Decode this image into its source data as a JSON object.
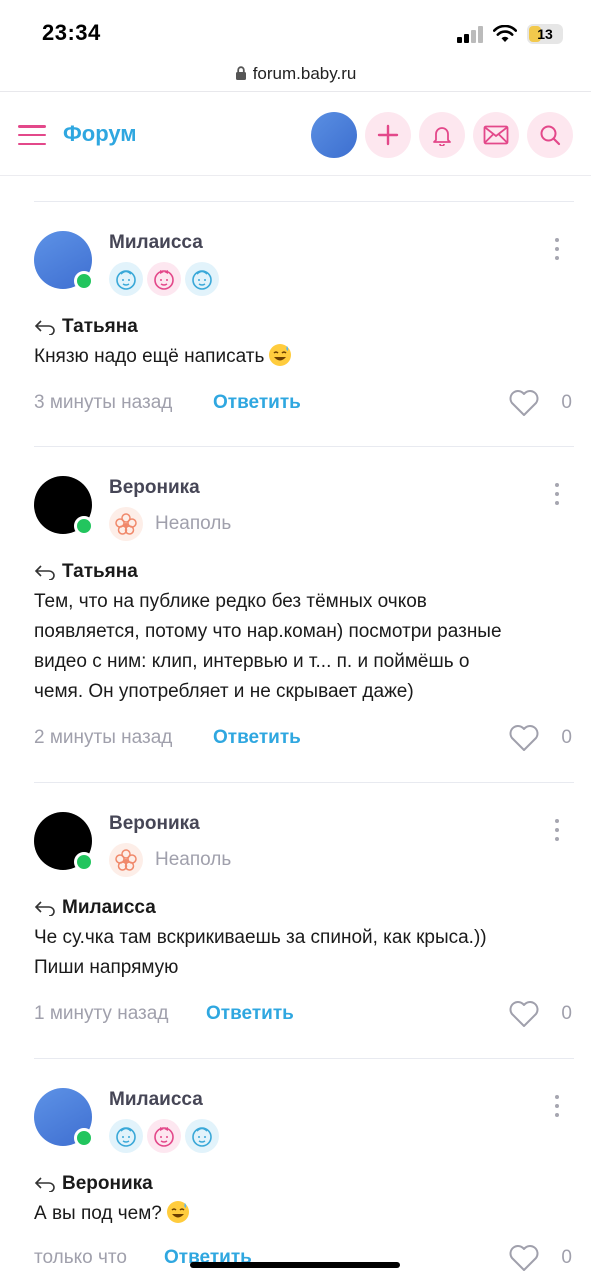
{
  "status_bar": {
    "time": "23:34",
    "battery": "13"
  },
  "browser": {
    "url": "forum.baby.ru"
  },
  "header": {
    "title": "Форум"
  },
  "comments": [
    {
      "author": "Милаисса",
      "reply_to": "Татьяна",
      "text": "Князю надо ещё написать",
      "time_ago": "3 минуты назад",
      "reply_label": "Ответить",
      "likes": "0"
    },
    {
      "author": "Вероника",
      "city": "Неаполь",
      "reply_to": "Татьяна",
      "text_lines": [
        "Тем, что на публике редко без тёмных очков",
        "появляется, потому что нар.коман) посмотри разные",
        "видео с ним: клип, интервью и т... п. и поймёшь о",
        "чемя. Он употребляет и не скрывает даже)"
      ],
      "time_ago": "2 минуты назад",
      "reply_label": "Ответить",
      "likes": "0"
    },
    {
      "author": "Вероника",
      "city": "Неаполь",
      "reply_to": "Милаисса",
      "text_lines": [
        "Че су.чка там вскрикиваешь за спиной, как крыса.))",
        "Пиши напрямую"
      ],
      "time_ago": "1 минуту назад",
      "reply_label": "Ответить",
      "likes": "0"
    },
    {
      "author": "Милаисса",
      "reply_to": "Вероника",
      "text": "А вы под чем?",
      "time_ago": "только что",
      "reply_label": "Ответить",
      "likes": "0"
    }
  ],
  "colors": {
    "accent_blue": "#2fa7e0",
    "accent_pink": "#e3488a",
    "online": "#22c55e"
  },
  "icons": [
    "hamburger-icon",
    "plus-icon",
    "bell-icon",
    "mail-icon",
    "search-icon",
    "heart-icon",
    "reply-arrow-icon",
    "lock-icon"
  ]
}
